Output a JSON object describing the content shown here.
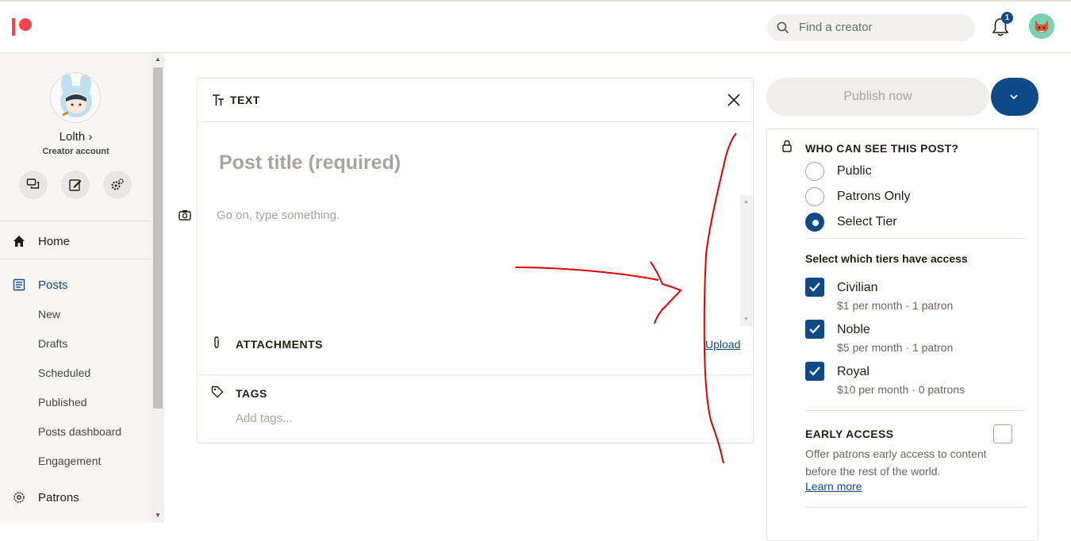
{
  "header": {
    "search_placeholder": "Find a creator",
    "notification_count": "1"
  },
  "sidebar": {
    "profile_name": "Lolth",
    "profile_chevron": "›",
    "profile_subtitle": "Creator account",
    "nav": {
      "home": "Home",
      "posts": "Posts",
      "posts_items": [
        "New",
        "Drafts",
        "Scheduled",
        "Published",
        "Posts dashboard",
        "Engagement"
      ],
      "patrons": "Patrons"
    }
  },
  "editor": {
    "section_label": "TEXT",
    "title_placeholder": "Post title (required)",
    "body_placeholder": "Go on, type something.",
    "attachments_label": "ATTACHMENTS",
    "upload_label": "Upload",
    "tags_label": "TAGS",
    "tags_placeholder": "Add tags..."
  },
  "publish": {
    "button_label": "Publish now"
  },
  "visibility": {
    "title": "WHO CAN SEE THIS POST?",
    "options": [
      {
        "label": "Public",
        "selected": false
      },
      {
        "label": "Patrons Only",
        "selected": false
      },
      {
        "label": "Select Tier",
        "selected": true
      }
    ],
    "tiers_title": "Select which tiers have access",
    "tiers": [
      {
        "name": "Civilian",
        "meta": "$1 per month · 1 patron",
        "checked": true
      },
      {
        "name": "Noble",
        "meta": "$5 per month · 1 patron",
        "checked": true
      },
      {
        "name": "Royal",
        "meta": "$10 per month · 0 patrons",
        "checked": true
      }
    ],
    "early_access": {
      "title": "EARLY ACCESS",
      "description": "Offer patrons early access to content before the rest of the world.",
      "learn_more": "Learn more",
      "checked": false
    }
  },
  "colors": {
    "brand": "#ff424d",
    "accent": "#0e4a87",
    "annotation": "#e00000"
  }
}
